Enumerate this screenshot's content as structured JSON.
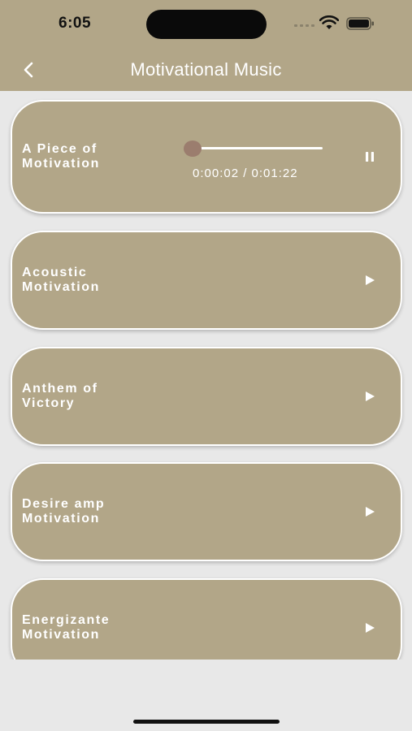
{
  "status_bar": {
    "time": "6:05"
  },
  "nav": {
    "title": "Motivational Music"
  },
  "tracks": [
    {
      "title": "A Piece of\nMotivation",
      "state": "playing",
      "elapsed": "0:00:02",
      "duration": "0:01:22",
      "time_display": "0:00:02 / 0:01:22",
      "progress": 0.02
    },
    {
      "title": "Acoustic\nMotivation",
      "state": "paused"
    },
    {
      "title": "Anthem of\nVictory",
      "state": "paused"
    },
    {
      "title": "Desire amp\nMotivation",
      "state": "paused"
    },
    {
      "title": "Energizante\nMotivation",
      "state": "paused"
    }
  ],
  "icons": {
    "back": "chevron-left-icon",
    "play": "play-icon",
    "pause": "pause-icon",
    "wifi": "wifi-icon",
    "battery": "battery-icon",
    "signal": "cellular-signal-icon"
  },
  "colors": {
    "header_bg": "#b2a688",
    "card_bg": "#b2a688",
    "page_bg": "#e8e8e8",
    "slider_thumb": "#9b7d6e"
  }
}
